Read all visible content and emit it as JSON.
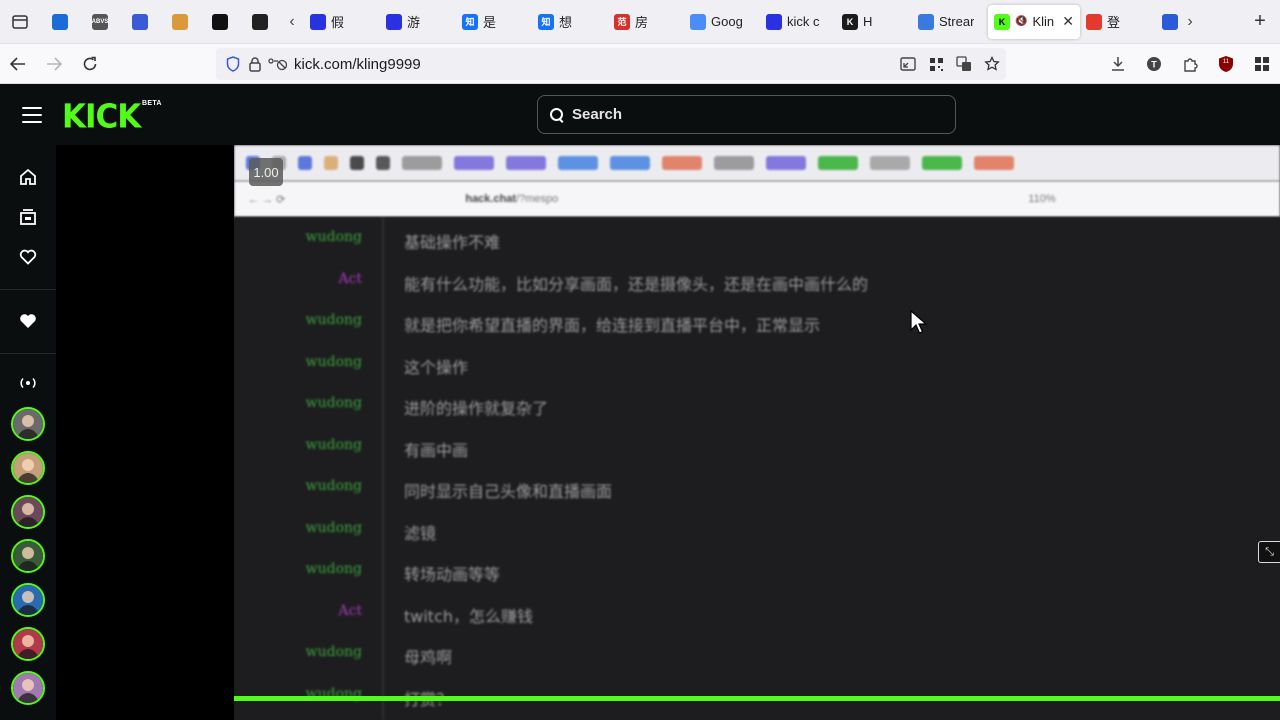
{
  "browser": {
    "pinned": [
      {
        "icon": "firefox-view-icon"
      },
      {
        "icon": "vercel-icon",
        "color": "#1a6dd8"
      },
      {
        "icon": "abvs-icon",
        "text": "ABVS",
        "color": "#555"
      },
      {
        "icon": "wave-icon",
        "color": "#3a5ad8"
      },
      {
        "icon": "box-icon",
        "color": "#d89a3a"
      },
      {
        "icon": "terminal-icon",
        "color": "#111"
      },
      {
        "icon": "hex-icon",
        "color": "#222"
      }
    ],
    "tabs": [
      {
        "label": "假",
        "icon": "baidu-icon",
        "color": "#2932e1"
      },
      {
        "label": "游",
        "icon": "baidu-icon",
        "color": "#2932e1"
      },
      {
        "label": "是",
        "icon": "zhihu-icon",
        "text": "知",
        "color": "#1772f6"
      },
      {
        "label": "想",
        "icon": "zhihu-icon",
        "text": "知",
        "color": "#1772f6"
      },
      {
        "label": "房",
        "icon": "fangtianxia-icon",
        "text": "范",
        "color": "#d8302f"
      },
      {
        "label": "Goog",
        "icon": "gemini-icon",
        "color": "#4b8df8"
      },
      {
        "label": "kick c",
        "icon": "baidu-icon",
        "color": "#2932e1"
      },
      {
        "label": "H",
        "icon": "kick-green-icon",
        "text": "K",
        "color": "#1b1b1b"
      },
      {
        "label": "Strear",
        "icon": "dot-icon",
        "color": "#3a7ae0"
      },
      {
        "label": "Klin",
        "icon": "kick-icon",
        "text": "K",
        "color": "#53fc18",
        "active": true
      },
      {
        "label": "登",
        "icon": "red-app-icon",
        "color": "#e23a2f"
      },
      {
        "label": "",
        "icon": "blue-dot-icon",
        "color": "#2a5ad8"
      }
    ],
    "url": "kick.com/kling9999"
  },
  "kick": {
    "logo_text": "KICK",
    "beta_label": "BETA",
    "search_placeholder": "Search"
  },
  "player": {
    "zoom_badge": "1.00",
    "inner_url_host": "hack.chat",
    "inner_url_path": "/?mespo",
    "inner_zoom": "110%",
    "progress_fraction": 1.0
  },
  "chat": {
    "colors": {
      "wudong": "#3ca53c",
      "act": "#a83ac0"
    },
    "messages": [
      {
        "nick": "wudong",
        "text": "基础操作不难"
      },
      {
        "nick": "Act",
        "text": "能有什么功能，比如分享画面，还是摄像头，还是在画中画什么的"
      },
      {
        "nick": "wudong",
        "text": "就是把你希望直播的界面，给连接到直播平台中，正常显示"
      },
      {
        "nick": "wudong",
        "text": "这个操作"
      },
      {
        "nick": "wudong",
        "text": "进阶的操作就复杂了"
      },
      {
        "nick": "wudong",
        "text": "有画中画"
      },
      {
        "nick": "wudong",
        "text": "同时显示自己头像和直播画面"
      },
      {
        "nick": "wudong",
        "text": "滤镜"
      },
      {
        "nick": "wudong",
        "text": "转场动画等等"
      },
      {
        "nick": "Act",
        "text": "twitch，怎么赚钱"
      },
      {
        "nick": "wudong",
        "text": "母鸡啊"
      },
      {
        "nick": "wudong",
        "text": "打赏？"
      }
    ]
  }
}
